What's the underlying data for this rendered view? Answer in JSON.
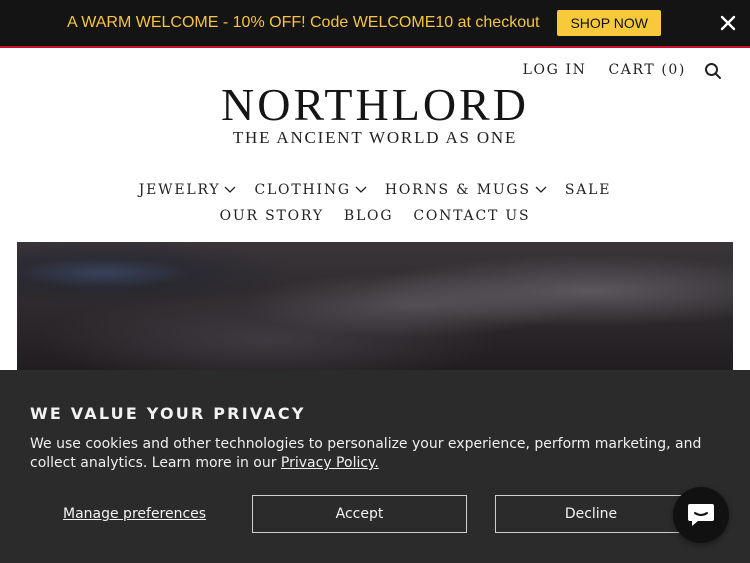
{
  "announcement": {
    "text": "A WARM WELCOME - 10% OFF! Code WELCOME10 at checkout",
    "button_label": "SHOP NOW",
    "close_icon": "close-icon"
  },
  "header": {
    "login_label": "LOG IN",
    "cart_label": "CART (0)",
    "search_icon": "search-icon",
    "logo_text": "NORTHLORD",
    "tagline": "THE ANCIENT WORLD AS ONE"
  },
  "nav": {
    "row1": [
      {
        "label": "JEWELRY",
        "has_dropdown": true
      },
      {
        "label": "CLOTHING",
        "has_dropdown": true
      },
      {
        "label": "HORNS & MUGS",
        "has_dropdown": true
      },
      {
        "label": "SALE",
        "has_dropdown": false
      }
    ],
    "row2": [
      {
        "label": "OUR STORY"
      },
      {
        "label": "BLOG"
      },
      {
        "label": "CONTACT US"
      }
    ]
  },
  "cookie_banner": {
    "title": "WE VALUE YOUR PRIVACY",
    "body": "We use cookies and other technologies to personalize your experience, perform marketing, and collect analytics. Learn more in our ",
    "policy_link": "Privacy Policy.",
    "manage_label": "Manage preferences",
    "accept_label": "Accept",
    "decline_label": "Decline"
  },
  "chat": {
    "icon": "chat-icon"
  },
  "colors": {
    "announce_bg": "#141414",
    "announce_text": "#f5c542",
    "shop_button": "#f7c93b",
    "announce_border": "#c8102e",
    "cookie_bg": "#2b2b2b"
  }
}
